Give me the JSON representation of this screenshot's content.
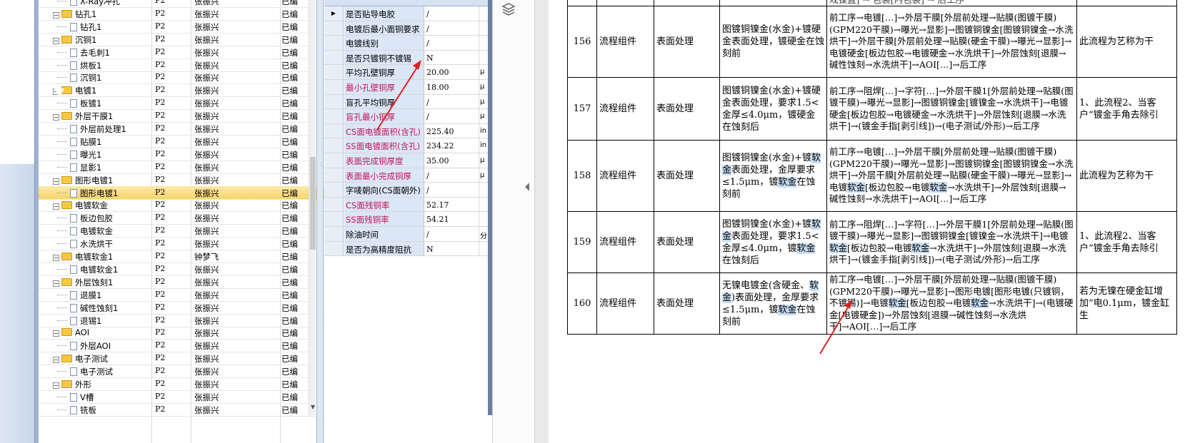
{
  "tree": {
    "rows": [
      {
        "name": "X-Ray冲孔",
        "p": "P2",
        "user": "张振兴",
        "status": "已编",
        "level": 2,
        "icon": "doc-icon"
      },
      {
        "name": "钻孔1",
        "p": "P2",
        "user": "张振兴",
        "status": "已编",
        "level": 1,
        "icon": "folder-icon"
      },
      {
        "name": "钻孔1",
        "p": "P2",
        "user": "张振兴",
        "status": "已编",
        "level": 2,
        "icon": "doc-icon"
      },
      {
        "name": "沉铜1",
        "p": "P2",
        "user": "张振兴",
        "status": "已编",
        "level": 1,
        "icon": "folder-icon"
      },
      {
        "name": "去毛刺1",
        "p": "P2",
        "user": "张振兴",
        "status": "已编",
        "level": 2,
        "icon": "doc-icon"
      },
      {
        "name": "烘板1",
        "p": "P2",
        "user": "张振兴",
        "status": "已编",
        "level": 2,
        "icon": "doc-icon"
      },
      {
        "name": "沉铜1",
        "p": "P2",
        "user": "张振兴",
        "status": "已编",
        "level": 2,
        "icon": "doc-icon"
      },
      {
        "name": "电镀1",
        "p": "P2",
        "user": "张振兴",
        "status": "已编",
        "level": 1,
        "icon": "folder-icon"
      },
      {
        "name": "板镀1",
        "p": "P2",
        "user": "张振兴",
        "status": "已编",
        "level": 2,
        "icon": "doc-icon"
      },
      {
        "name": "外层干膜1",
        "p": "P2",
        "user": "张振兴",
        "status": "已编",
        "level": 1,
        "icon": "folder-icon"
      },
      {
        "name": "外层前处理1",
        "p": "P2",
        "user": "张振兴",
        "status": "已编",
        "level": 2,
        "icon": "doc-icon"
      },
      {
        "name": "贴膜1",
        "p": "P2",
        "user": "张振兴",
        "status": "已编",
        "level": 2,
        "icon": "doc-icon"
      },
      {
        "name": "曝光1",
        "p": "P2",
        "user": "张振兴",
        "status": "已编",
        "level": 2,
        "icon": "doc-icon"
      },
      {
        "name": "显影1",
        "p": "P2",
        "user": "张振兴",
        "status": "已编",
        "level": 2,
        "icon": "doc-icon"
      },
      {
        "name": "图形电镀1",
        "p": "P2",
        "user": "张振兴",
        "status": "已编",
        "level": 1,
        "icon": "folder-icon"
      },
      {
        "name": "图形电镀1",
        "p": "P2",
        "user": "张振兴",
        "status": "已编",
        "level": 2,
        "icon": "doc-icon",
        "selected": true
      },
      {
        "name": "电镀软金",
        "p": "P2",
        "user": "张振兴",
        "status": "已编",
        "level": 1,
        "icon": "folder-icon"
      },
      {
        "name": "板边包胶",
        "p": "P2",
        "user": "张振兴",
        "status": "已编",
        "level": 2,
        "icon": "doc-icon"
      },
      {
        "name": "电镀软金",
        "p": "P2",
        "user": "张振兴",
        "status": "已编",
        "level": 2,
        "icon": "doc-icon"
      },
      {
        "name": "水洗烘干",
        "p": "P2",
        "user": "张振兴",
        "status": "已编",
        "level": 2,
        "icon": "doc-icon"
      },
      {
        "name": "电镀软金1",
        "p": "P2",
        "user": "钟梦飞",
        "status": "已编",
        "level": 1,
        "icon": "folder-icon"
      },
      {
        "name": "电镀软金1",
        "p": "P2",
        "user": "张振兴",
        "status": "已编",
        "level": 2,
        "icon": "doc-icon"
      },
      {
        "name": "外层蚀刻1",
        "p": "P2",
        "user": "张振兴",
        "status": "已编",
        "level": 1,
        "icon": "folder-icon"
      },
      {
        "name": "退膜1",
        "p": "P2",
        "user": "张振兴",
        "status": "已编",
        "level": 2,
        "icon": "doc-icon"
      },
      {
        "name": "碱性蚀刻1",
        "p": "P2",
        "user": "张振兴",
        "status": "已编",
        "level": 2,
        "icon": "doc-icon"
      },
      {
        "name": "退锡1",
        "p": "P2",
        "user": "张振兴",
        "status": "已编",
        "level": 2,
        "icon": "doc-icon"
      },
      {
        "name": "AOI",
        "p": "P2",
        "user": "张振兴",
        "status": "已编",
        "level": 1,
        "icon": "folder-icon"
      },
      {
        "name": "外层AOI",
        "p": "P2",
        "user": "张振兴",
        "status": "已编",
        "level": 2,
        "icon": "doc-icon"
      },
      {
        "name": "电子测试",
        "p": "P2",
        "user": "张振兴",
        "status": "已编",
        "level": 1,
        "icon": "folder-icon"
      },
      {
        "name": "电子测试",
        "p": "P2",
        "user": "张振兴",
        "status": "已编",
        "level": 2,
        "icon": "doc-icon"
      },
      {
        "name": "外形",
        "p": "P2",
        "user": "张振兴",
        "status": "已编",
        "level": 1,
        "icon": "folder-icon"
      },
      {
        "name": "V槽",
        "p": "P2",
        "user": "张振兴",
        "status": "已编",
        "level": 2,
        "icon": "doc-icon"
      },
      {
        "name": "铣板",
        "p": "P2",
        "user": "张振兴",
        "status": "已编",
        "level": 2,
        "icon": "doc-icon"
      }
    ]
  },
  "props": {
    "rows": [
      {
        "label": "是否贴导电胶",
        "value": "/",
        "unit": "",
        "red": false,
        "current": true
      },
      {
        "label": "电镀后最小面铜要求",
        "value": "/",
        "unit": "",
        "red": false
      },
      {
        "label": "电镀线别",
        "value": "/",
        "unit": "",
        "red": false
      },
      {
        "label": "是否只镀铜不镀锡",
        "value": "N",
        "unit": "",
        "red": false
      },
      {
        "label": "平均孔壁铜厚",
        "value": "20.00",
        "unit": "μ",
        "red": false
      },
      {
        "label": "最小孔壁铜厚",
        "value": "18.00",
        "unit": "μ",
        "red": true
      },
      {
        "label": "盲孔平均铜厚",
        "value": "/",
        "unit": "μ",
        "red": false
      },
      {
        "label": "盲孔最小铜厚",
        "value": "/",
        "unit": "μ",
        "red": true
      },
      {
        "label": "CS面电镀面积(含孔)",
        "value": "225.40",
        "unit": "in",
        "red": true
      },
      {
        "label": "SS面电镀面积(含孔)",
        "value": "234.22",
        "unit": "in",
        "red": true
      },
      {
        "label": "表面完成铜厚度",
        "value": "35.00",
        "unit": "μ",
        "red": true
      },
      {
        "label": "表面最小完成铜厚",
        "value": "/",
        "unit": "μ",
        "red": true
      },
      {
        "label": "字唛朝向(CS面朝外)",
        "value": "/",
        "unit": "",
        "red": false
      },
      {
        "label": "CS面残铜率",
        "value": "52.17",
        "unit": "",
        "red": true
      },
      {
        "label": "SS面残铜率",
        "value": "54.21",
        "unit": "",
        "red": true
      },
      {
        "label": "除油时间",
        "value": "/",
        "unit": "分",
        "red": false
      },
      {
        "label": "是否为高精度阻抗",
        "value": "N",
        "unit": "",
        "red": false
      }
    ]
  },
  "doc": {
    "top_partial": "戏镍直] → 包装[内包装] → 后工序",
    "rows": [
      {
        "no": "156",
        "type": "流程组件",
        "category": "表面处理",
        "requirement": "图镀铜镍金(水金)+镀硬金表面处理，镀硬金在蚀刻前",
        "flow": "前工序→电镀[…]→外层干膜[外层前处理→贴膜(图镀干膜)(GPM220干膜)→曝光→显影]→图镀铜镍金[图镀铜镍金→水洗烘干]→外层干膜[外层前处理→贴膜(硬金干膜)→曝光→显影]→电镀硬金[板边包胶→电镀硬金→水洗烘干]→外层蚀刻[退膜→碱性蚀刻→水洗烘干]→AOI[…]→后工序",
        "note": "此流程为艺称为干"
      },
      {
        "no": "157",
        "type": "流程组件",
        "category": "表面处理",
        "requirement": "图镀铜镍金(水金)+镀硬金表面处理，要求1.5<金厚≤4.0μm，镀硬金在蚀刻后",
        "flow": "前工序→阻焊[…]→字符[…]→外层干膜1[外层前处理→贴膜(图镀干膜)→曝光→显影]→图镀铜镍金[镀镍金→水洗烘干]→电镀硬金[板边包胶→电镀硬金→水洗烘干]→外层蚀刻[退膜→水洗烘干]→(镀金手指[剥引线])→(电子测试/外形)→后工序",
        "note": "1、此流程2、当客户“镀金手角去除引"
      },
      {
        "no": "158",
        "type": "流程组件",
        "category": "表面处理",
        "requirement": "图镀铜镍金(水金)+镀软金表面处理，金厚要求≤1.5μm，镀软金在蚀刻前",
        "flow": "前工序→电镀[…]→外层干膜[外层前处理→贴膜(图镀干膜)(GPM220干膜)→曝光→显影]→图镀铜镍金[图镀铜镍金→水洗烘干]→外层干膜[外层前处理→贴膜(硬金干膜)→曝光→显影]→电镀软金[板边包胶→电镀软金→水洗烘干]→外层蚀刻[退膜→碱性蚀刻→水洗烘干]→AOI[…]→后工序",
        "note": "此流程为艺称为干"
      },
      {
        "no": "159",
        "type": "流程组件",
        "category": "表面处理",
        "requirement": "图镀铜镍金(水金)+镀软金表面处理，要求1.5<金厚≤4.0μm，镀软金在蚀刻后",
        "flow": "前工序→阻焊[…]→字符[…]→外层干膜1[外层前处理→贴膜(图镀干膜)→曝光→显影]→图镀铜镍金[镀镍金→水洗烘干]→电镀软金[板边包胶→电镀软金→水洗烘干]→外层蚀刻[退膜→水洗烘干]→(镀金手指[剥引线])→(电子测试/外形)→后工序",
        "note": "1、此流程2、当客户“镀金手角去除引"
      },
      {
        "no": "160",
        "type": "流程组件",
        "category": "表面处理",
        "requirement": "无镍电镀金(含硬金、软金)表面处理，金厚要求≤1.5μm，镀软金在蚀刻前",
        "flow": "前工序→电镀[…]→外层干膜[外层前处理→贴膜(图镀干膜)(GPM220干膜)→曝光→显影]→图形电镀[图形电镀(只镀铜，不镀锡)]→电镀软金[板边包胶→电镀软金→水洗烘干]→(电镀硬金[电镀硬金])→外层蚀刻[退膜→碱性蚀刻→水洗烘干]→AOI[…]→后工序",
        "note": "若为无镍在硬金缸增加“电0.1μm，镀金缸生"
      }
    ]
  },
  "colors": {
    "selection": "#f8d46c",
    "label_red": "#c0185a",
    "highlight": "#c7ddf3",
    "arrow": "#e02020"
  }
}
